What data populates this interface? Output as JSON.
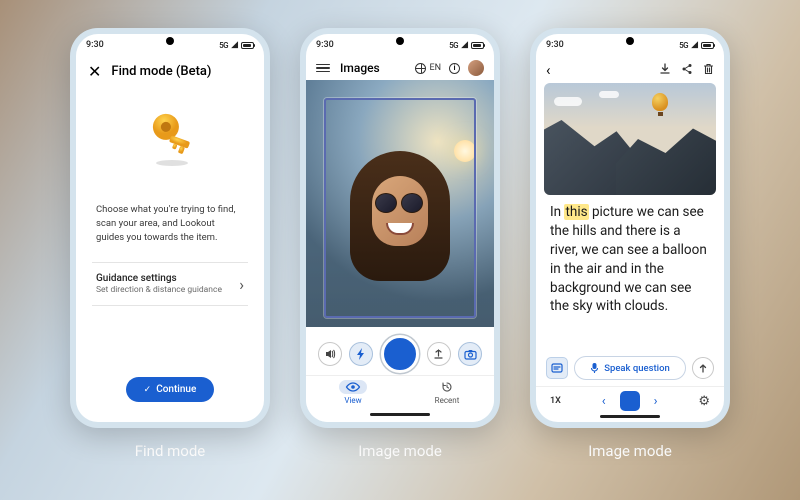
{
  "status": {
    "time": "9:30",
    "network": "5G",
    "signal": "▲◢"
  },
  "phone1": {
    "title": "Find mode (Beta)",
    "description": "Choose what you're trying to find, scan your area, and Lookout guides you towards the item.",
    "setting_title": "Guidance settings",
    "setting_sub": "Set direction & distance guidance",
    "continue": "Continue",
    "caption": "Find mode"
  },
  "phone2": {
    "title": "Images",
    "lang": "EN",
    "tab_view": "View",
    "tab_recent": "Recent",
    "caption": "Image mode"
  },
  "phone3": {
    "desc_pre": "In ",
    "desc_hl": "this",
    "desc_post": " picture we can see the hills and there is a river, we can see a balloon in the air and in the background we can see the sky with clouds.",
    "speak": "Speak question",
    "zoom": "1X",
    "caption": "Image mode"
  }
}
